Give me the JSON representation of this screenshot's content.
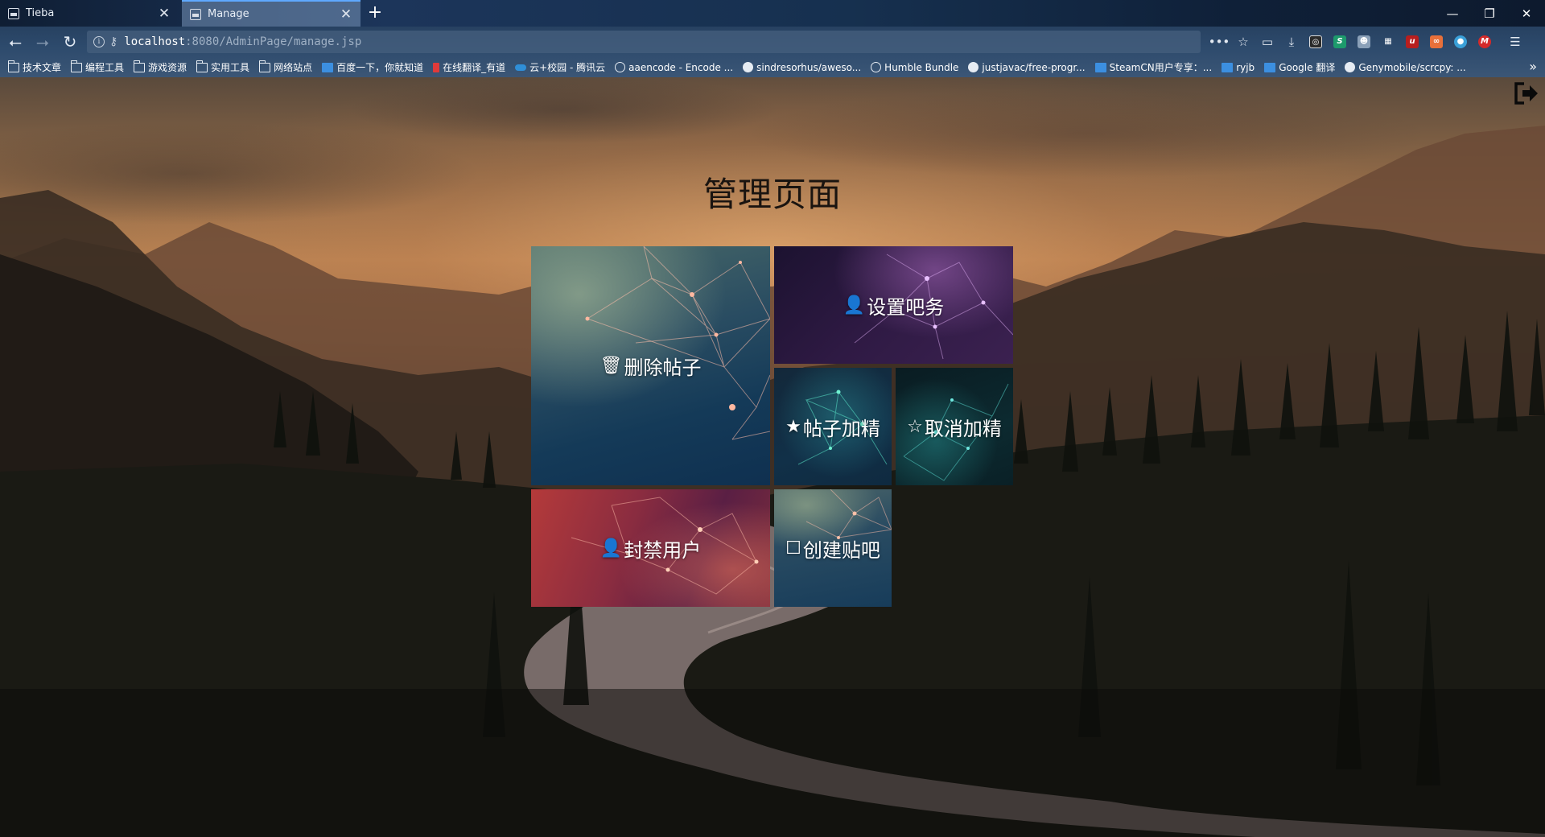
{
  "browser": {
    "tabs": [
      {
        "label": "Tieba",
        "active": false
      },
      {
        "label": "Manage",
        "active": true
      }
    ],
    "new_tab_label": "+",
    "url_host": "localhost",
    "url_rest": ":8080/AdminPage/manage.jsp",
    "bookmarks": [
      {
        "label": "技术文章",
        "icon": "folder"
      },
      {
        "label": "编程工具",
        "icon": "folder"
      },
      {
        "label": "游戏资源",
        "icon": "folder"
      },
      {
        "label": "实用工具",
        "icon": "folder"
      },
      {
        "label": "网络站点",
        "icon": "folder"
      },
      {
        "label": "百度一下，你就知道",
        "icon": "baidu"
      },
      {
        "label": "在线翻译_有道",
        "icon": "youdao"
      },
      {
        "label": "云+校园 - 腾讯云",
        "icon": "tencent-cloud"
      },
      {
        "label": "aaencode - Encode ...",
        "icon": "globe"
      },
      {
        "label": "sindresorhus/aweso...",
        "icon": "github"
      },
      {
        "label": "Humble Bundle",
        "icon": "globe"
      },
      {
        "label": "justjavac/free-progr...",
        "icon": "github"
      },
      {
        "label": "SteamCN用户专享：...",
        "icon": "steamcn"
      },
      {
        "label": "ryjb",
        "icon": "ryjb"
      },
      {
        "label": "Google 翻译",
        "icon": "google-translate"
      },
      {
        "label": "Genymobile/scrcpy: ...",
        "icon": "github"
      }
    ]
  },
  "page": {
    "title": "管理页面",
    "tiles": {
      "delete_post": {
        "label": "删除帖子",
        "icon": "trash-icon"
      },
      "set_bar_affairs": {
        "label": "设置吧务",
        "icon": "user-icon"
      },
      "feature_post": {
        "label": "帖子加精",
        "icon": "star-filled-icon"
      },
      "unfeature_post": {
        "label": "取消加精",
        "icon": "star-outline-icon"
      },
      "ban_user": {
        "label": "封禁用户",
        "icon": "user-icon"
      },
      "create_bar": {
        "label": "创建贴吧",
        "icon": "square-icon"
      }
    }
  },
  "colors": {
    "accent_tab": "#5fa9ff",
    "title_text": "#1a1410",
    "tile_text": "#ffffff"
  }
}
